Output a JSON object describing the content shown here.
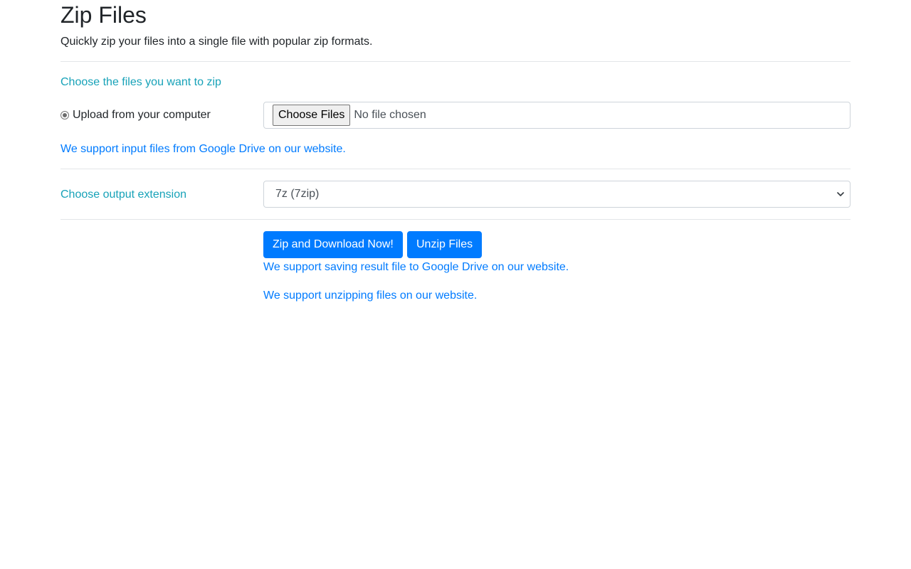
{
  "page": {
    "title": "Zip Files",
    "subtitle": "Quickly zip your files into a single file with popular zip formats."
  },
  "files_section": {
    "heading": "Choose the files you want to zip",
    "upload_option_label": "Upload from your computer",
    "upload_option_selected": true,
    "choose_files_label": "Choose Files",
    "no_file_text": "No file chosen",
    "google_drive_input_note": "We support input files from Google Drive on our website."
  },
  "output_section": {
    "label": "Choose output extension",
    "selected_extension": "7z (7zip)"
  },
  "actions": {
    "zip_download_label": "Zip and Download Now!",
    "unzip_label": "Unzip Files",
    "google_drive_save_note": "We support saving result file to Google Drive on our website.",
    "unzip_note": "We support unzipping files on our website."
  },
  "colors": {
    "accent_teal": "#17a2b8",
    "link_blue": "#007bff",
    "primary_button": "#007bff",
    "text": "#212529"
  }
}
